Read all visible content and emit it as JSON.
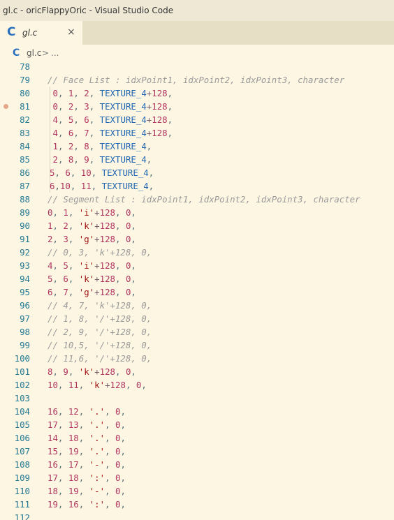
{
  "window": {
    "title": "gl.c - oricFlappyOric - Visual Studio Code"
  },
  "tab": {
    "icon": "C",
    "icon_name": "c-file-icon",
    "label": "gl.c",
    "close": "×"
  },
  "breadcrumb": {
    "icon": "C",
    "file": "gl.c",
    "separator": ">",
    "more": "..."
  },
  "colors": {
    "background": "#fdf6e3",
    "line_number": "#237893",
    "comment": "#9a9a9a",
    "number": "#b0355f",
    "string": "#a31515",
    "constant": "#1e65b2",
    "breakpoint": "#e5a78a"
  },
  "editor": {
    "breakpoint_line": "81",
    "lines": [
      {
        "n": "78",
        "text": ""
      },
      {
        "n": "79",
        "text": "// Face List : idxPoint1, idxPoint2, idxPoint3, character"
      },
      {
        "n": "80",
        "text": " 0, 1, 2, TEXTURE_4+128,"
      },
      {
        "n": "81",
        "text": " 0, 2, 3, TEXTURE_4+128,"
      },
      {
        "n": "82",
        "text": " 4, 5, 6, TEXTURE_4+128,"
      },
      {
        "n": "83",
        "text": " 4, 6, 7, TEXTURE_4+128,"
      },
      {
        "n": "84",
        "text": " 1, 2, 8, TEXTURE_4,"
      },
      {
        "n": "85",
        "text": " 2, 8, 9, TEXTURE_4,"
      },
      {
        "n": "86",
        "text": "5, 6, 10, TEXTURE_4,"
      },
      {
        "n": "87",
        "text": "6,10, 11, TEXTURE_4,"
      },
      {
        "n": "88",
        "text": "// Segment List : idxPoint1, idxPoint2, idxPoint3, character"
      },
      {
        "n": "89",
        "text": "0, 1, 'i'+128, 0,"
      },
      {
        "n": "90",
        "text": "1, 2, 'k'+128, 0,"
      },
      {
        "n": "91",
        "text": "2, 3, 'g'+128, 0,"
      },
      {
        "n": "92",
        "text": "// 0, 3, 'k'+128, 0,"
      },
      {
        "n": "93",
        "text": "4, 5, 'i'+128, 0,"
      },
      {
        "n": "94",
        "text": "5, 6, 'k'+128, 0,"
      },
      {
        "n": "95",
        "text": "6, 7, 'g'+128, 0,"
      },
      {
        "n": "96",
        "text": "// 4, 7, 'k'+128, 0,"
      },
      {
        "n": "97",
        "text": "// 1, 8, '/'+128, 0,"
      },
      {
        "n": "98",
        "text": "// 2, 9, '/'+128, 0,"
      },
      {
        "n": "99",
        "text": "// 10,5, '/'+128, 0,"
      },
      {
        "n": "100",
        "text": "// 11,6, '/'+128, 0,"
      },
      {
        "n": "101",
        "text": "8, 9, 'k'+128, 0,"
      },
      {
        "n": "102",
        "text": "10, 11, 'k'+128, 0,"
      },
      {
        "n": "103",
        "text": ""
      },
      {
        "n": "104",
        "text": "16, 12, '.', 0,"
      },
      {
        "n": "105",
        "text": "17, 13, '.', 0,"
      },
      {
        "n": "106",
        "text": "14, 18, '.', 0,"
      },
      {
        "n": "107",
        "text": "15, 19, '.', 0,"
      },
      {
        "n": "108",
        "text": "16, 17, '-', 0,"
      },
      {
        "n": "109",
        "text": "17, 18, ':', 0,"
      },
      {
        "n": "110",
        "text": "18, 19, '-', 0,"
      },
      {
        "n": "111",
        "text": "19, 16, ':', 0,"
      },
      {
        "n": "112",
        "text": ""
      }
    ]
  }
}
